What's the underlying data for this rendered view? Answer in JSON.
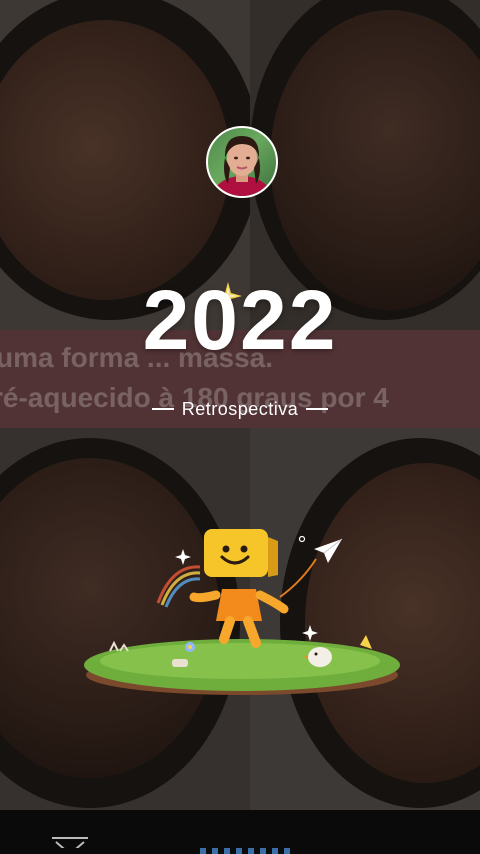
{
  "story": {
    "year": "2022",
    "subtitle": "Retrospectiva",
    "background_caption_line1": "uma forma ... massa.",
    "background_caption_line2": "ré-aquecido à 180 graus por 4"
  },
  "icons": {
    "avatar": "profile-avatar",
    "sparkle": "sparkle-icon",
    "mascot": "smiley-box-mascot",
    "paper_plane": "paper-plane-icon",
    "nav_back": "triangle-back-icon"
  },
  "colors": {
    "banner": "#7a4a4d",
    "accent_gold": "#f6d34a",
    "mascot_orange": "#f28a1c",
    "grass": "#6fae3c"
  }
}
